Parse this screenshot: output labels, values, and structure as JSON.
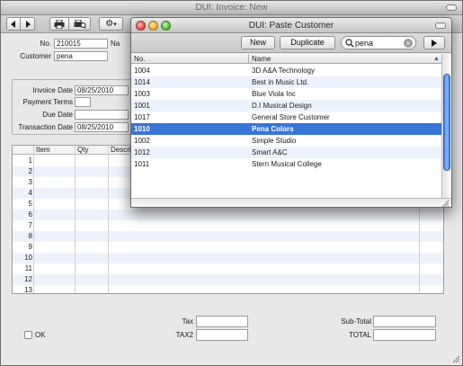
{
  "main_window": {
    "title": "DUI: Invoice: New",
    "toolbar": {
      "gear": "⚙",
      "menu_arrow": "▾"
    },
    "header": {
      "no_label": "No.",
      "no_value": "210015",
      "name_label": "Na",
      "customer_label": "Customer",
      "customer_value": "pena"
    },
    "dates": {
      "invoice_date_label": "Invoice Date",
      "invoice_date_value": "08/25/2010",
      "payment_terms_label": "Payment Terms",
      "payment_terms_value": "",
      "due_date_label": "Due Date",
      "due_date_value": "",
      "transaction_date_label": "Transaction Date",
      "transaction_date_value": "08/25/2010"
    },
    "grid": {
      "columns": [
        "Item",
        "Qty",
        "Descri"
      ],
      "row_numbers": [
        "1",
        "2",
        "3",
        "4",
        "5",
        "6",
        "7",
        "8",
        "9",
        "10",
        "11",
        "12",
        "13"
      ]
    },
    "footer": {
      "ok_label": "OK",
      "tax_label": "Tax",
      "tax2_label": "TAX2",
      "subtotal_label": "Sub-Total",
      "total_label": "TOTAL"
    }
  },
  "paste_window": {
    "title": "DUI: Paste Customer",
    "new_label": "New",
    "duplicate_label": "Duplicate",
    "search_value": "pena",
    "search_icon": "🔍",
    "clear_icon": "×",
    "go_icon": "▶",
    "columns": {
      "no": "No.",
      "name": "Name"
    },
    "sort_indicator": "▲",
    "selected_no": "1010",
    "rows": [
      {
        "no": "1004",
        "name": "3D A&A Technology"
      },
      {
        "no": "1014",
        "name": "Best in Music Ltd."
      },
      {
        "no": "1003",
        "name": "Blue Viola Inc"
      },
      {
        "no": "1001",
        "name": "D.I Musical Design"
      },
      {
        "no": "1017",
        "name": "General Store Customer"
      },
      {
        "no": "1010",
        "name": "Pena Colors"
      },
      {
        "no": "1002",
        "name": "Simple Studio"
      },
      {
        "no": "1012",
        "name": "Smart A&C"
      },
      {
        "no": "1011",
        "name": "Stern Musical College"
      }
    ]
  },
  "colors": {
    "selection": "#3875d7",
    "close_light": "#e8534a",
    "minimize_light": "#f2b431",
    "zoom_light": "#5cbf3c"
  }
}
